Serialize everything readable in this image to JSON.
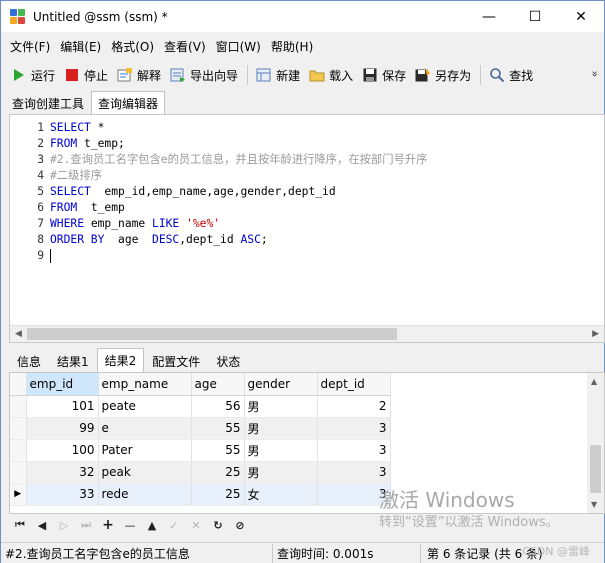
{
  "window": {
    "title": "Untitled @ssm (ssm) *",
    "minimize": "—",
    "maximize": "☐",
    "close": "✕"
  },
  "menu": [
    "文件(F)",
    "编辑(E)",
    "格式(O)",
    "查看(V)",
    "窗口(W)",
    "帮助(H)"
  ],
  "toolbar": {
    "run": "运行",
    "stop": "停止",
    "explain": "解释",
    "export_wizard": "导出向导",
    "new": "新建",
    "load": "载入",
    "save": "保存",
    "save_as": "另存为",
    "find": "查找",
    "more": "»"
  },
  "tabs_top": [
    "查询创建工具",
    "查询编辑器"
  ],
  "editor": {
    "line_numbers": [
      "1",
      "2",
      "3",
      "4",
      "5",
      "6",
      "7",
      "8",
      "9"
    ],
    "lines": {
      "l1": {
        "kw": "SELECT",
        "tx": " *"
      },
      "l2": {
        "kw": "FROM",
        "tx": " t_emp;"
      },
      "l3": {
        "cm": "#2.查询员工名字包含e的员工信息，并且按年龄进行降序，在按部门号升序"
      },
      "l4": {
        "cm": "#二级排序"
      },
      "l5": {
        "kw": "SELECT",
        "tx": "  emp_id,emp_name,age,gender,dept_id"
      },
      "l6": {
        "kw": "FROM",
        "tx": "  t_emp"
      },
      "l7": {
        "kw": "WHERE",
        "tx": " emp_name ",
        "kw2": "LIKE",
        "sp": " ",
        "str": "'%e%'"
      },
      "l8": {
        "kw": "ORDER BY",
        "tx": "  age  ",
        "kw2": "DESC",
        "tx2": ",dept_id ",
        "kw3": "ASC",
        "tx3": ";"
      }
    }
  },
  "result_tabs": [
    "信息",
    "结果1",
    "结果2",
    "配置文件",
    "状态"
  ],
  "grid": {
    "columns": [
      "emp_id",
      "emp_name",
      "age",
      "gender",
      "dept_id"
    ],
    "rows": [
      [
        "101",
        "peate",
        "56",
        "男",
        "2"
      ],
      [
        "99",
        "e",
        "55",
        "男",
        "3"
      ],
      [
        "100",
        "Pater",
        "55",
        "男",
        "3"
      ],
      [
        "32",
        "peak",
        "25",
        "男",
        "3"
      ],
      [
        "33",
        "rede",
        "25",
        "女",
        "3"
      ]
    ],
    "current_row_marker": "▶"
  },
  "watermark": {
    "line1": "激活 Windows",
    "line2": "转到“设置”以激活 Windows。"
  },
  "nav": [
    "⏮",
    "◀",
    "▷",
    "⏭",
    "+",
    "—",
    "▲",
    "✓",
    "✕",
    "↻",
    "⊘"
  ],
  "status": {
    "sql": "#2.查询员工名字包含e的员工信息",
    "time": "查询时间: 0.001s",
    "records": "第 6 条记录 (共 6 条)",
    "csdn": "CSDN @雷峰"
  }
}
